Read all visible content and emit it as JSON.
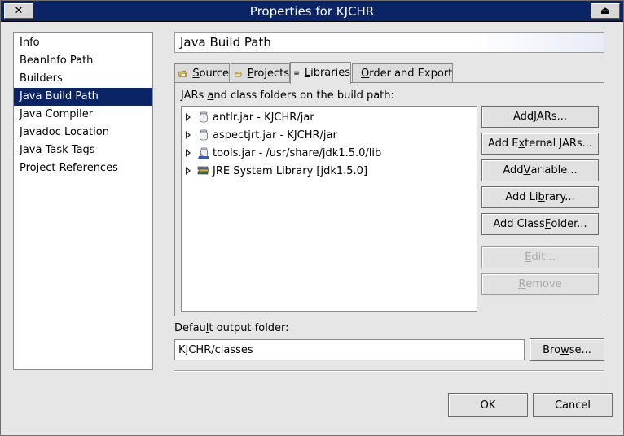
{
  "window": {
    "title": "Properties for KJCHR",
    "close_glyph": "✕",
    "maximize_glyph": "⏏"
  },
  "nav": {
    "items": [
      {
        "label": "Info",
        "selected": false
      },
      {
        "label": "BeanInfo Path",
        "selected": false
      },
      {
        "label": "Builders",
        "selected": false
      },
      {
        "label": "Java Build Path",
        "selected": true
      },
      {
        "label": "Java Compiler",
        "selected": false
      },
      {
        "label": "Javadoc Location",
        "selected": false
      },
      {
        "label": "Java Task Tags",
        "selected": false
      },
      {
        "label": "Project References",
        "selected": false
      }
    ]
  },
  "page": {
    "title": "Java Build Path"
  },
  "tabs": [
    {
      "mnemonic": "S",
      "rest": "ource",
      "icon": "source-folder-icon",
      "active": false
    },
    {
      "mnemonic": "P",
      "rest": "rojects",
      "icon": "projects-icon",
      "active": false
    },
    {
      "mnemonic": "L",
      "rest": "ibraries",
      "icon": "libraries-icon",
      "active": true
    },
    {
      "mnemonic": "O",
      "rest": "rder and Export",
      "icon": "order-export-icon",
      "active": false
    }
  ],
  "libraries": {
    "label_pre": "JARs ",
    "label_mnemonic": "a",
    "label_post": "nd class folders on the build path:",
    "entries": [
      {
        "label": "antlr.jar - KJCHR/jar",
        "icon": "jar-icon"
      },
      {
        "label": "aspectjrt.jar - KJCHR/jar",
        "icon": "jar-icon"
      },
      {
        "label": "tools.jar - /usr/share/jdk1.5.0/lib",
        "icon": "external-jar-icon"
      },
      {
        "label": "JRE System Library [jdk1.5.0]",
        "icon": "library-icon"
      }
    ],
    "buttons": [
      {
        "pre": "Add ",
        "mn": "J",
        "post": "ARs...",
        "enabled": true
      },
      {
        "pre": "Add E",
        "mn": "x",
        "post": "ternal JARs...",
        "enabled": true
      },
      {
        "pre": "Add ",
        "mn": "V",
        "post": "ariable...",
        "enabled": true
      },
      {
        "pre": "Add Li",
        "mn": "b",
        "post": "rary...",
        "enabled": true
      },
      {
        "pre": "Add Class ",
        "mn": "F",
        "post": "older...",
        "enabled": true
      },
      {
        "pre": "",
        "mn": "E",
        "post": "dit...",
        "enabled": false
      },
      {
        "pre": "",
        "mn": "R",
        "post": "emove",
        "enabled": false
      }
    ]
  },
  "output": {
    "label_pre": "Defau",
    "label_mnemonic": "l",
    "label_post": "t output folder:",
    "value": "KJCHR/classes",
    "browse_pre": "Bro",
    "browse_mnemonic": "w",
    "browse_post": "se..."
  },
  "footer": {
    "ok": "OK",
    "cancel": "Cancel"
  },
  "colors": {
    "titlebar": "#0b2466",
    "selection": "#0b2466",
    "dialog_bg": "#e6e6e6"
  }
}
